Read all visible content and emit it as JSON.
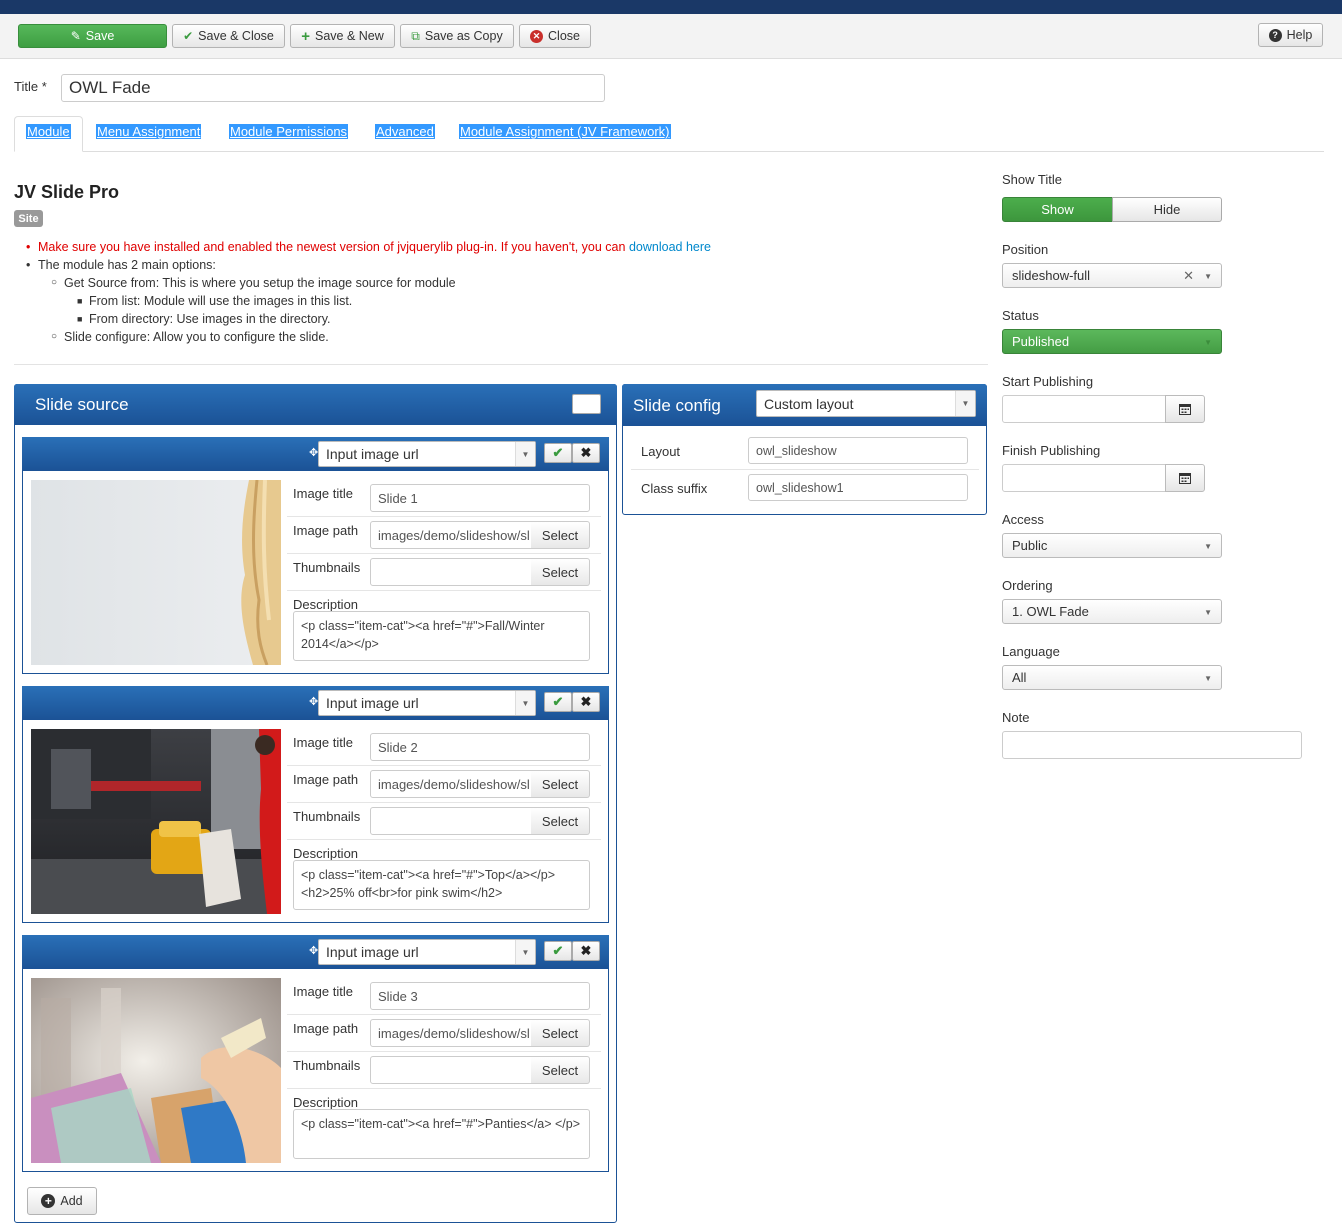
{
  "toolbar": {
    "save": "Save",
    "save_close": "Save & Close",
    "save_new": "Save & New",
    "save_copy": "Save as Copy",
    "close": "Close",
    "help": "Help"
  },
  "title_field": {
    "label": "Title *",
    "value": "OWL Fade"
  },
  "tabs": [
    "Module",
    "Menu Assignment",
    "Module Permissions",
    "Advanced",
    "Module Assignment (JV Framework)"
  ],
  "module": {
    "name": "JV Slide Pro",
    "badge": "Site",
    "warning": "Make sure you have installed and enabled the newest version of jvjquerylib plug-in. If you haven't, you can",
    "warning_link": "download here",
    "options_intro": "The module has 2 main options:",
    "get_source": "Get Source from: This is where you setup the image source for module",
    "from_list": "From list: Module will use the images in this list.",
    "from_directory": "From directory: Use images in the directory.",
    "slide_configure": "Slide configure: Allow you to configure the slide."
  },
  "slide_source": {
    "heading": "Slide source",
    "add_label": "Add",
    "field_labels": {
      "title": "Image title",
      "path": "Image path",
      "thumbs": "Thumbnails",
      "desc": "Description",
      "select": "Select"
    },
    "slides": [
      {
        "source_type": "Input image url",
        "title": "Slide 1",
        "path": "images/demo/slideshow/sl",
        "thumbnail": "",
        "description": "<p class=\"item-cat\"><a href=\"#\">Fall/Winter 2014</a></p>"
      },
      {
        "source_type": "Input image url",
        "title": "Slide 2",
        "path": "images/demo/slideshow/sl",
        "thumbnail": "",
        "description": "<p class=\"item-cat\"><a href=\"#\">Top</a></p> <h2>25% off<br>for pink swim</h2>"
      },
      {
        "source_type": "Input image url",
        "title": "Slide 3",
        "path": "images/demo/slideshow/sl",
        "thumbnail": "",
        "description": "<p class=\"item-cat\"><a href=\"#\">Panties</a> </p>"
      }
    ]
  },
  "slide_config": {
    "heading": "Slide config",
    "layout_type": "Custom layout",
    "layout_label": "Layout",
    "layout_value": "owl_slideshow",
    "suffix_label": "Class suffix",
    "suffix_value": "owl_slideshow1"
  },
  "right": {
    "show_title_label": "Show Title",
    "show": "Show",
    "hide": "Hide",
    "position_label": "Position",
    "position_value": "slideshow-full",
    "status_label": "Status",
    "status_value": "Published",
    "start_label": "Start Publishing",
    "start_value": "",
    "finish_label": "Finish Publishing",
    "finish_value": "",
    "access_label": "Access",
    "access_value": "Public",
    "ordering_label": "Ordering",
    "ordering_value": "1. OWL Fade",
    "language_label": "Language",
    "language_value": "All",
    "note_label": "Note",
    "note_value": ""
  },
  "colors": {
    "accent_blue": "#1b5296",
    "success_green": "#46a546",
    "warning_red": "#e00000",
    "link_blue": "#0088cc"
  }
}
